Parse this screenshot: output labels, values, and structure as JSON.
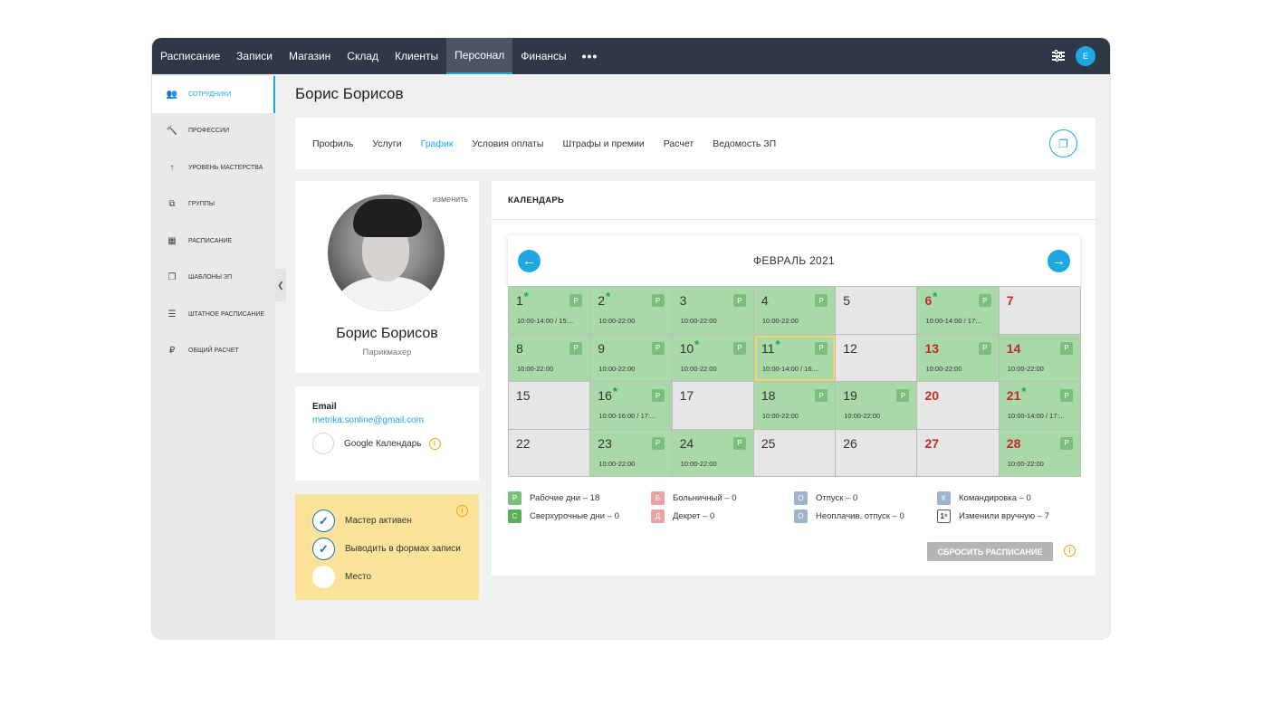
{
  "nav": {
    "items": [
      {
        "label": "Расписание",
        "active": false
      },
      {
        "label": "Записи",
        "active": false
      },
      {
        "label": "Магазин",
        "active": false
      },
      {
        "label": "Склад",
        "active": false
      },
      {
        "label": "Клиенты",
        "active": false
      },
      {
        "label": "Персонал",
        "active": true
      },
      {
        "label": "Финансы",
        "active": false
      }
    ],
    "more": "•••",
    "avatar_letter": "E"
  },
  "sidebar": {
    "items": [
      {
        "label": "сотрудники",
        "icon": "users-icon",
        "glyph": "👥",
        "active": true
      },
      {
        "label": "профессии",
        "icon": "hammer-icon",
        "glyph": "🔨",
        "active": false
      },
      {
        "label": "уровень мастерства",
        "icon": "level-up-icon",
        "glyph": "↑",
        "active": false
      },
      {
        "label": "группы",
        "icon": "groups-icon",
        "glyph": "⧉",
        "active": false
      },
      {
        "label": "расписание",
        "icon": "calendar-icon",
        "glyph": "▦",
        "active": false
      },
      {
        "label": "шаблоны зп",
        "icon": "templates-icon",
        "glyph": "❐",
        "active": false
      },
      {
        "label": "штатное расписание",
        "icon": "list-icon",
        "glyph": "☰",
        "active": false
      },
      {
        "label": "общий расчет",
        "icon": "ruble-icon",
        "glyph": "₽",
        "active": false
      }
    ]
  },
  "page": {
    "title": "Борис Борисов"
  },
  "tabs": [
    {
      "label": "Профиль",
      "active": false
    },
    {
      "label": "Услуги",
      "active": false
    },
    {
      "label": "График",
      "active": true
    },
    {
      "label": "Условия оплаты",
      "active": false
    },
    {
      "label": "Штрафы и премии",
      "active": false
    },
    {
      "label": "Расчет",
      "active": false
    },
    {
      "label": "Ведомость ЗП",
      "active": false
    }
  ],
  "profile": {
    "edit": "изменить",
    "name": "Борис Борисов",
    "role": "Парикмахер"
  },
  "contact": {
    "email_label": "Email",
    "email": "metrika.sonline@gmail.com",
    "gcal_label": "Google Календарь",
    "info": "i"
  },
  "flags": [
    {
      "label": "Мастер активен",
      "checked": true
    },
    {
      "label": "Выводить в формах записи",
      "checked": true
    },
    {
      "label": "Место",
      "checked": false
    }
  ],
  "calendar": {
    "header": "КАЛЕНДАРЬ",
    "month": "ФЕВРАЛЬ 2021",
    "prev": "←",
    "next": "→",
    "badge": "Р",
    "star": "*",
    "days": [
      {
        "d": "1",
        "work": true,
        "star": true,
        "red": false,
        "time": "10:00-14:00 / 15:..."
      },
      {
        "d": "2",
        "work": true,
        "star": true,
        "red": false,
        "time": "10:00-22:00"
      },
      {
        "d": "3",
        "work": true,
        "star": false,
        "red": false,
        "time": "10:00-22:00"
      },
      {
        "d": "4",
        "work": true,
        "star": false,
        "red": false,
        "time": "10:00-22:00"
      },
      {
        "d": "5",
        "work": false,
        "star": false,
        "red": false,
        "time": ""
      },
      {
        "d": "6",
        "work": true,
        "star": true,
        "red": true,
        "time": "10:00-14:00 / 17:..."
      },
      {
        "d": "7",
        "work": false,
        "star": false,
        "red": true,
        "time": ""
      },
      {
        "d": "8",
        "work": true,
        "star": false,
        "red": false,
        "time": "10:00-22:00"
      },
      {
        "d": "9",
        "work": true,
        "star": false,
        "red": false,
        "time": "10:00-22:00"
      },
      {
        "d": "10",
        "work": true,
        "star": true,
        "red": false,
        "time": "10:00-22:00"
      },
      {
        "d": "11",
        "work": true,
        "star": true,
        "red": false,
        "time": "10:00-14:00 / 16:...",
        "selected": true
      },
      {
        "d": "12",
        "work": false,
        "star": false,
        "red": false,
        "time": ""
      },
      {
        "d": "13",
        "work": true,
        "star": false,
        "red": true,
        "time": "10:00-22:00"
      },
      {
        "d": "14",
        "work": true,
        "star": false,
        "red": true,
        "time": "10:00-22:00"
      },
      {
        "d": "15",
        "work": false,
        "star": false,
        "red": false,
        "time": ""
      },
      {
        "d": "16",
        "work": true,
        "star": true,
        "red": false,
        "time": "10:00-16:00 / 17:..."
      },
      {
        "d": "17",
        "work": false,
        "star": false,
        "red": false,
        "time": ""
      },
      {
        "d": "18",
        "work": true,
        "star": false,
        "red": false,
        "time": "10:00-22:00"
      },
      {
        "d": "19",
        "work": true,
        "star": false,
        "red": false,
        "time": "10:00-22:00"
      },
      {
        "d": "20",
        "work": false,
        "star": false,
        "red": true,
        "time": ""
      },
      {
        "d": "21",
        "work": true,
        "star": true,
        "red": true,
        "time": "10:00-14:00 / 17:..."
      },
      {
        "d": "22",
        "work": false,
        "star": false,
        "red": false,
        "time": ""
      },
      {
        "d": "23",
        "work": true,
        "star": false,
        "red": false,
        "time": "10:00-22:00"
      },
      {
        "d": "24",
        "work": true,
        "star": false,
        "red": false,
        "time": "10:00-22:00"
      },
      {
        "d": "25",
        "work": false,
        "star": false,
        "red": false,
        "time": ""
      },
      {
        "d": "26",
        "work": false,
        "star": false,
        "red": false,
        "time": ""
      },
      {
        "d": "27",
        "work": false,
        "star": false,
        "red": true,
        "time": ""
      },
      {
        "d": "28",
        "work": true,
        "star": false,
        "red": true,
        "time": "10:00-22:00"
      }
    ],
    "legend": [
      {
        "badge": "Р",
        "style": "green",
        "label": "Рабочие дни – 18"
      },
      {
        "badge": "С",
        "style": "dkgreen",
        "label": "Сверхурочные дни – 0"
      },
      {
        "badge": "Б",
        "style": "pink",
        "label": "Больничный – 0"
      },
      {
        "badge": "Д",
        "style": "pink",
        "label": "Декрет – 0"
      },
      {
        "badge": "О",
        "style": "blue",
        "label": "Отпуск – 0"
      },
      {
        "badge": "О",
        "style": "blue",
        "label": "Неоплачив. отпуск – 0"
      },
      {
        "badge": "К",
        "style": "blue",
        "label": "Командировка – 0"
      },
      {
        "badge": "1*",
        "style": "manual",
        "label": "Изменили вручную – 7"
      }
    ],
    "reset_label": "СБРОСИТЬ РАСПИСАНИЕ"
  },
  "colors": {
    "accent": "#1ea7e1",
    "work_day": "#a9d9a9",
    "off_day": "#e6e6e6",
    "weekend_text": "#c62828",
    "nav_bg": "#2f3846"
  }
}
